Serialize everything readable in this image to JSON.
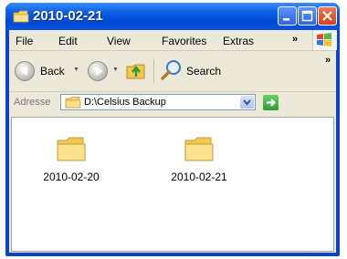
{
  "window": {
    "title": "2010-02-21"
  },
  "menu": {
    "items": [
      "File",
      "Edit",
      "View",
      "Favorites",
      "Extras"
    ]
  },
  "toolbar": {
    "back_label": "Back",
    "search_label": "Search"
  },
  "address": {
    "label": "Adresse",
    "path": "D:\\Celsius Backup"
  },
  "files": [
    {
      "name": "2010-02-20"
    },
    {
      "name": "2010-02-21"
    }
  ],
  "colors": {
    "titlebar": "#0a5fe6",
    "client": "#ece9d8",
    "accent_green": "#2e9a2e"
  }
}
